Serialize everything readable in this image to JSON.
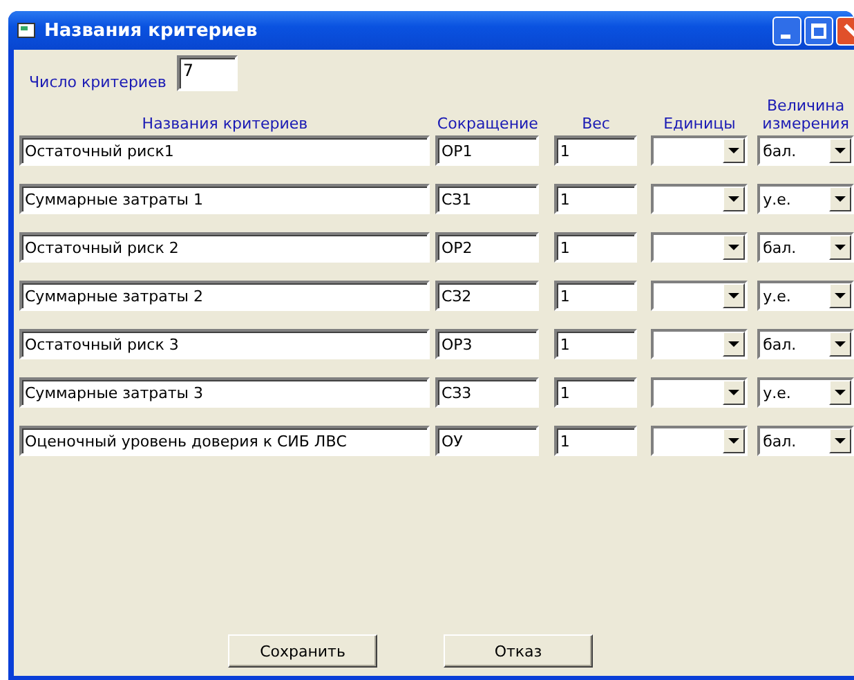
{
  "window": {
    "title": "Названия критериев"
  },
  "count": {
    "label": "Число критериев",
    "value": "7"
  },
  "columns": [
    "Названия критериев",
    "Сокращение",
    "Вес",
    "Единицы",
    "Величина измерения"
  ],
  "rows": [
    {
      "name": "Остаточный риск1",
      "abbr": "ОР1",
      "weight": "1",
      "measure": "бал."
    },
    {
      "name": "Суммарные затраты 1",
      "abbr": "СЗ1",
      "weight": "1",
      "measure": "у.е."
    },
    {
      "name": "Остаточный риск 2",
      "abbr": "ОР2",
      "weight": "1",
      "measure": "бал."
    },
    {
      "name": "Суммарные затраты 2",
      "abbr": "СЗ2",
      "weight": "1",
      "measure": "у.е."
    },
    {
      "name": "Остаточный риск 3",
      "abbr": "ОР3",
      "weight": "1",
      "measure": "бал."
    },
    {
      "name": "Суммарные затраты 3",
      "abbr": "СЗ3",
      "weight": "1",
      "measure": "у.е."
    },
    {
      "name": "Оценочный уровень доверия к СИБ ЛВС",
      "abbr": "ОУ",
      "weight": "1",
      "measure": "бал."
    }
  ],
  "buttons": [
    "Сохранить",
    "Отказ"
  ]
}
